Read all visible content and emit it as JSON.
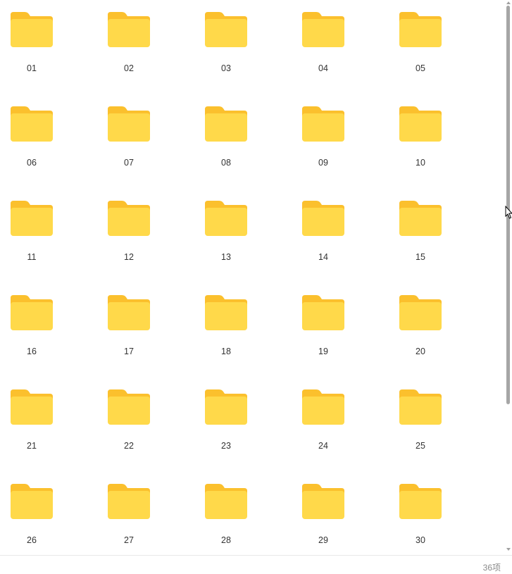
{
  "folders": [
    {
      "name": "01"
    },
    {
      "name": "02"
    },
    {
      "name": "03"
    },
    {
      "name": "04"
    },
    {
      "name": "05"
    },
    {
      "name": "06"
    },
    {
      "name": "07"
    },
    {
      "name": "08"
    },
    {
      "name": "09"
    },
    {
      "name": "10"
    },
    {
      "name": "11"
    },
    {
      "name": "12"
    },
    {
      "name": "13"
    },
    {
      "name": "14"
    },
    {
      "name": "15"
    },
    {
      "name": "16"
    },
    {
      "name": "17"
    },
    {
      "name": "18"
    },
    {
      "name": "19"
    },
    {
      "name": "20"
    },
    {
      "name": "21"
    },
    {
      "name": "22"
    },
    {
      "name": "23"
    },
    {
      "name": "24"
    },
    {
      "name": "25"
    },
    {
      "name": "26"
    },
    {
      "name": "27"
    },
    {
      "name": "28"
    },
    {
      "name": "29"
    },
    {
      "name": "30"
    }
  ],
  "folder_icon": "folder-icon",
  "colors": {
    "folder_front": "#FFD94A",
    "folder_back": "#FBC02D"
  },
  "status_bar": {
    "item_count": "36项"
  }
}
